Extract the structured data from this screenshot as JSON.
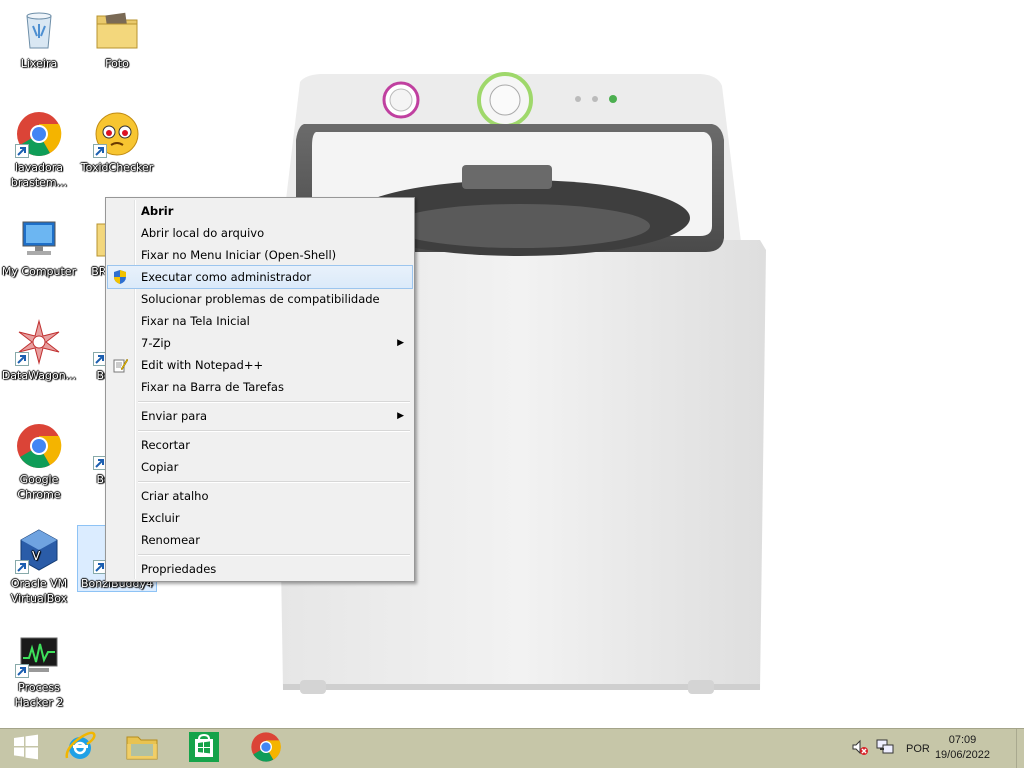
{
  "desktop": {
    "icons": [
      {
        "label": "Lixeira",
        "icon": "recycle-bin-icon"
      },
      {
        "label": "Foto",
        "icon": "folder-icon"
      },
      {
        "label": "lavadora brastem...",
        "icon": "chrome-shortcut-icon"
      },
      {
        "label": "ToxidChecker",
        "icon": "emoji-face-icon"
      },
      {
        "label": "My Computer",
        "icon": "my-computer-icon"
      },
      {
        "label": "BR… W…",
        "icon": "folder-icon"
      },
      {
        "label": "DataWagon...",
        "icon": "datawagon-icon"
      },
      {
        "label": "Bonzi…",
        "icon": "bonzi-icon"
      },
      {
        "label": "Google Chrome",
        "icon": "chrome-icon"
      },
      {
        "label": "Bonzi…",
        "icon": "bonzi-icon"
      },
      {
        "label": "Oracle VM VirtualBox",
        "icon": "virtualbox-icon"
      },
      {
        "label": "BonziBuddy4",
        "icon": "bonzi-icon"
      },
      {
        "label": "Process Hacker 2",
        "icon": "process-hacker-icon"
      }
    ]
  },
  "context_menu": {
    "items": [
      {
        "label": "Abrir",
        "bold": true
      },
      {
        "label": "Abrir local do arquivo"
      },
      {
        "label": "Fixar no Menu Iniciar (Open-Shell)"
      },
      {
        "label": "Executar como administrador",
        "icon": "uac-shield-icon",
        "highlighted": true
      },
      {
        "label": "Solucionar problemas de compatibilidade"
      },
      {
        "label": "Fixar na Tela Inicial"
      },
      {
        "label": "7-Zip",
        "submenu": true
      },
      {
        "label": "Edit with Notepad++",
        "icon": "notepad-plus-plus-icon"
      },
      {
        "label": "Fixar na Barra de Tarefas"
      },
      {
        "label": "Enviar para",
        "submenu": true
      },
      {
        "label": "Recortar"
      },
      {
        "label": "Copiar"
      },
      {
        "label": "Criar atalho"
      },
      {
        "label": "Excluir"
      },
      {
        "label": "Renomear"
      },
      {
        "label": "Propriedades"
      }
    ]
  },
  "taskbar": {
    "pinned": [
      "windows-start-icon",
      "internet-explorer-icon",
      "file-explorer-icon",
      "windows-store-icon",
      "chrome-icon"
    ],
    "tray": {
      "volume_icon": "volume-muted-icon",
      "network_icon": "network-icon",
      "language": "POR",
      "time": "07:09",
      "date": "19/06/2022"
    }
  },
  "colors": {
    "taskbar": "#c6c6a8",
    "menu_bg": "#f0f0f0",
    "menu_highlight": "#dbeafa"
  }
}
